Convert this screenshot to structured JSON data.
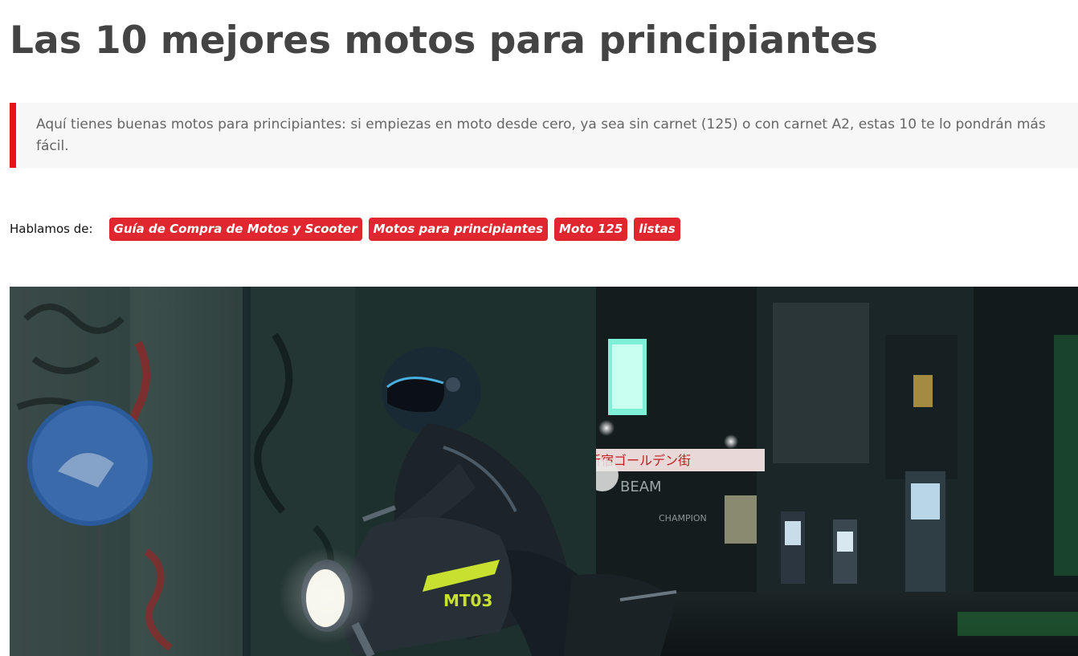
{
  "article": {
    "title": "Las 10 mejores motos para principiantes",
    "summary": "Aquí tienes buenas motos para principiantes: si empiezas en moto desde cero, ya sea sin carnet (125) o con carnet A2, estas 10 te lo pondrán más fácil."
  },
  "tags": {
    "label": "Hablamos de:",
    "items": [
      "Guía de Compra de Motos y Scooter",
      "Motos para principiantes",
      "Moto 125",
      "listas"
    ]
  },
  "hero": {
    "sign_text": "新宿ゴールデン街",
    "beam_text": "BEAM",
    "champion_text": "CHAMPION",
    "bike_badge": "MT03"
  },
  "colors": {
    "accent": "#e0262e",
    "title": "#444444",
    "summary_text": "#666666",
    "summary_bg": "#f7f7f7"
  }
}
